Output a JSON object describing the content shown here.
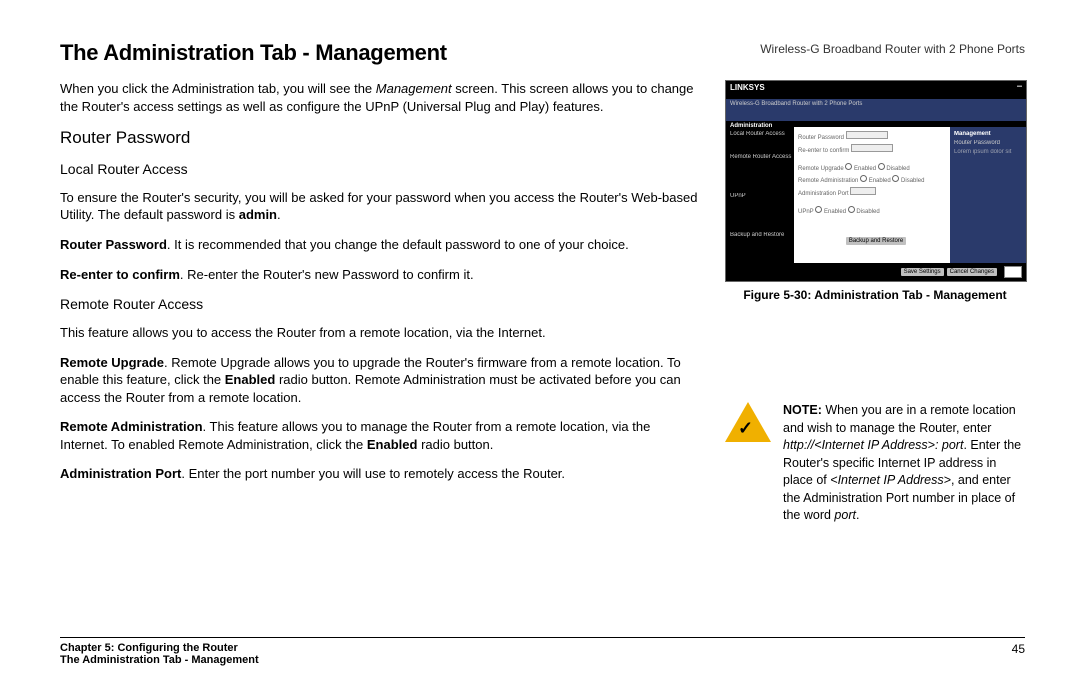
{
  "header": {
    "product": "Wireless-G Broadband Router with 2 Phone Ports"
  },
  "title": "The Administration Tab - Management",
  "intro_pre": "When you click the Administration tab, you will see the ",
  "intro_em": "Management",
  "intro_post": " screen. This screen allows you to change the Router's access settings as well as configure the UPnP (Universal Plug and Play) features.",
  "sections": {
    "router_password": "Router Password",
    "local_access": "Local Router Access",
    "local_p1": "To ensure the Router's security, you will be asked for your password when you access the Router's Web-based Utility. The default password is ",
    "local_p1_bold": "admin",
    "local_p1_end": ".",
    "rp_bold": "Router Password",
    "rp_text": ". It is recommended that you change the default password to one of your choice.",
    "re_bold": "Re-enter to confirm",
    "re_text": ". Re-enter the Router's new Password to confirm it.",
    "remote_access": "Remote Router Access",
    "remote_p1": "This feature allows you to access the Router from a remote location, via the Internet.",
    "ru_bold": "Remote Upgrade",
    "ru_text1": ". Remote Upgrade allows you to upgrade the Router's firmware from a remote location. To enable this feature, click the ",
    "ru_text_bold": "Enabled",
    "ru_text2": " radio button. Remote Administration must be activated before you can access the Router from a remote location.",
    "ra_bold": "Remote Administration",
    "ra_text1": ". This feature allows you to manage the Router from a remote location, via the Internet. To enabled Remote Administration, click the ",
    "ra_text_bold": "Enabled",
    "ra_text2": " radio button.",
    "ap_bold": "Administration Port",
    "ap_text": ". Enter the port number you will use to remotely access the Router."
  },
  "figure": {
    "caption": "Figure 5-30: Administration Tab - Management",
    "brand": "LINKSYS",
    "banner": "Wireless-G Broadband Router with 2 Phone Ports",
    "tab": "Administration",
    "left_labels": [
      "Local Router Access",
      "Remote Router Access",
      "UPnP",
      "Backup and Restore"
    ],
    "right_title": "Management",
    "btn_backup": "Backup and Restore",
    "btn_save": "Save Settings",
    "btn_cancel": "Cancel Changes"
  },
  "note": {
    "bold": "NOTE:",
    "t1": "  When you are in a remote location and wish to manage the Router, enter ",
    "em1": "http://<Internet IP Address>: port",
    "t2": ". Enter the Router's specific Internet IP address in place of ",
    "em2": "<Internet IP Address>",
    "t3": ", and enter the Administration Port number in place of the word ",
    "em3": "port",
    "t4": "."
  },
  "footer": {
    "chapter": "Chapter 5: Configuring the Router",
    "section": "The Administration Tab - Management",
    "page": "45"
  }
}
